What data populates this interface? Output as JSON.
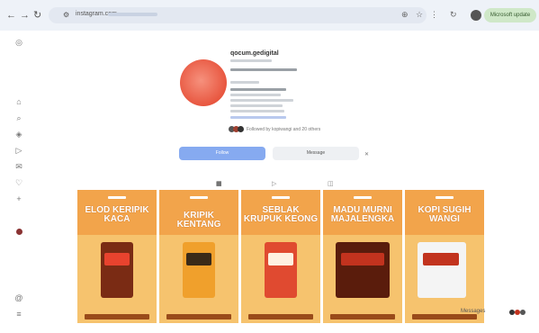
{
  "browser": {
    "url": "instagram.com",
    "update_label": "Microsoft update"
  },
  "profile": {
    "username": "qocum.gedigital",
    "followers_text": "Followed by kopiwangi and 20 others"
  },
  "buttons": {
    "follow_label": "Follow",
    "message_label": "Message"
  },
  "posts": [
    {
      "title": "ELOD KERIPIK KACA",
      "product_label": "ELOD"
    },
    {
      "title": "KRIPIK KENTANG",
      "product_label": "KENTANG"
    },
    {
      "title": "SEBLAK KRUPUK KEONG",
      "product_label": "SEBLAK"
    },
    {
      "title": "MADU MURNI MAJALENGKA",
      "product_label": "MADU"
    },
    {
      "title": "KOPI SUGIH WANGI",
      "product_label": "SUGIH WANGI"
    }
  ],
  "chat": {
    "label": "Messages"
  }
}
